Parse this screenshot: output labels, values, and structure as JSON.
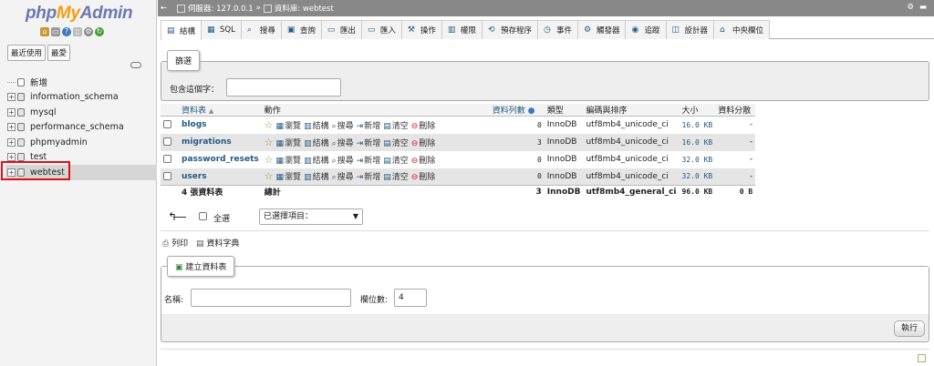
{
  "nav": {
    "logo_php": "php",
    "logo_my": "My",
    "logo_admin": "Admin",
    "tabs": [
      "最近使用",
      "最愛"
    ],
    "databases": [
      {
        "name": "新增",
        "kind": "new"
      },
      {
        "name": "information_schema",
        "kind": "db"
      },
      {
        "name": "mysql",
        "kind": "db"
      },
      {
        "name": "performance_schema",
        "kind": "db"
      },
      {
        "name": "phpmyadmin",
        "kind": "db"
      },
      {
        "name": "test",
        "kind": "db"
      },
      {
        "name": "webtest",
        "kind": "db",
        "selected": true
      }
    ]
  },
  "breadcrumb": {
    "server": "伺服器: 127.0.0.1",
    "separator": "»",
    "database": "資料庫: webtest"
  },
  "tabs": [
    {
      "label": "結構",
      "icon": "structure-icon",
      "glyph": "▤"
    },
    {
      "label": "SQL",
      "icon": "sql-icon",
      "glyph": "▦"
    },
    {
      "label": "搜尋",
      "icon": "search-icon",
      "glyph": "⌕"
    },
    {
      "label": "查詢",
      "icon": "query-icon",
      "glyph": "▣"
    },
    {
      "label": "匯出",
      "icon": "export-icon",
      "glyph": "▭"
    },
    {
      "label": "匯入",
      "icon": "import-icon",
      "glyph": "▭"
    },
    {
      "label": "操作",
      "icon": "operations-icon",
      "glyph": "⚒"
    },
    {
      "label": "權限",
      "icon": "privileges-icon",
      "glyph": "▥"
    },
    {
      "label": "預存程序",
      "icon": "routines-icon",
      "glyph": "⟲"
    },
    {
      "label": "事件",
      "icon": "events-icon",
      "glyph": "◷"
    },
    {
      "label": "觸發器",
      "icon": "triggers-icon",
      "glyph": "⚙"
    },
    {
      "label": "追蹤",
      "icon": "tracking-icon",
      "glyph": "◉"
    },
    {
      "label": "設計器",
      "icon": "designer-icon",
      "glyph": "◫"
    },
    {
      "label": "中央欄位",
      "icon": "central-columns-icon",
      "glyph": "⌂"
    }
  ],
  "filter": {
    "legend": "篩選",
    "label": "包含這個字：",
    "value": ""
  },
  "table": {
    "headers": {
      "name": "資料表",
      "sort": "▲",
      "action": "動作",
      "rows": "資料列數",
      "type": "類型",
      "collation": "編碼與排序",
      "size": "大小",
      "overhead": "資料分散"
    },
    "actions": [
      "瀏覽",
      "結構",
      "搜尋",
      "新增",
      "清空",
      "刪除"
    ],
    "rows": [
      {
        "name": "blogs",
        "rows": "0",
        "type": "InnoDB",
        "collation": "utf8mb4_unicode_ci",
        "size": "16.0 KB",
        "overhead": "-"
      },
      {
        "name": "migrations",
        "rows": "3",
        "type": "InnoDB",
        "collation": "utf8mb4_unicode_ci",
        "size": "16.0 KB",
        "overhead": "-"
      },
      {
        "name": "password_resets",
        "rows": "0",
        "type": "InnoDB",
        "collation": "utf8mb4_unicode_ci",
        "size": "32.0 KB",
        "overhead": "-"
      },
      {
        "name": "users",
        "rows": "0",
        "type": "InnoDB",
        "collation": "utf8mb4_unicode_ci",
        "size": "32.0 KB",
        "overhead": "-"
      }
    ],
    "footer": {
      "count": "4 張資料表",
      "action": "總計",
      "rows": "3",
      "type": "InnoDB",
      "collation": "utf8mb4_general_ci",
      "size": "96.0 KB",
      "overhead": "0 B"
    }
  },
  "bulk": {
    "check_all": "全選",
    "with_selected": "已選擇項目："
  },
  "links": {
    "print": "列印",
    "dictionary": "資料字典"
  },
  "create": {
    "legend": "建立資料表",
    "name_label": "名稱:",
    "name_value": "",
    "columns_label": "欄位數:",
    "columns_value": "4",
    "go": "執行"
  }
}
